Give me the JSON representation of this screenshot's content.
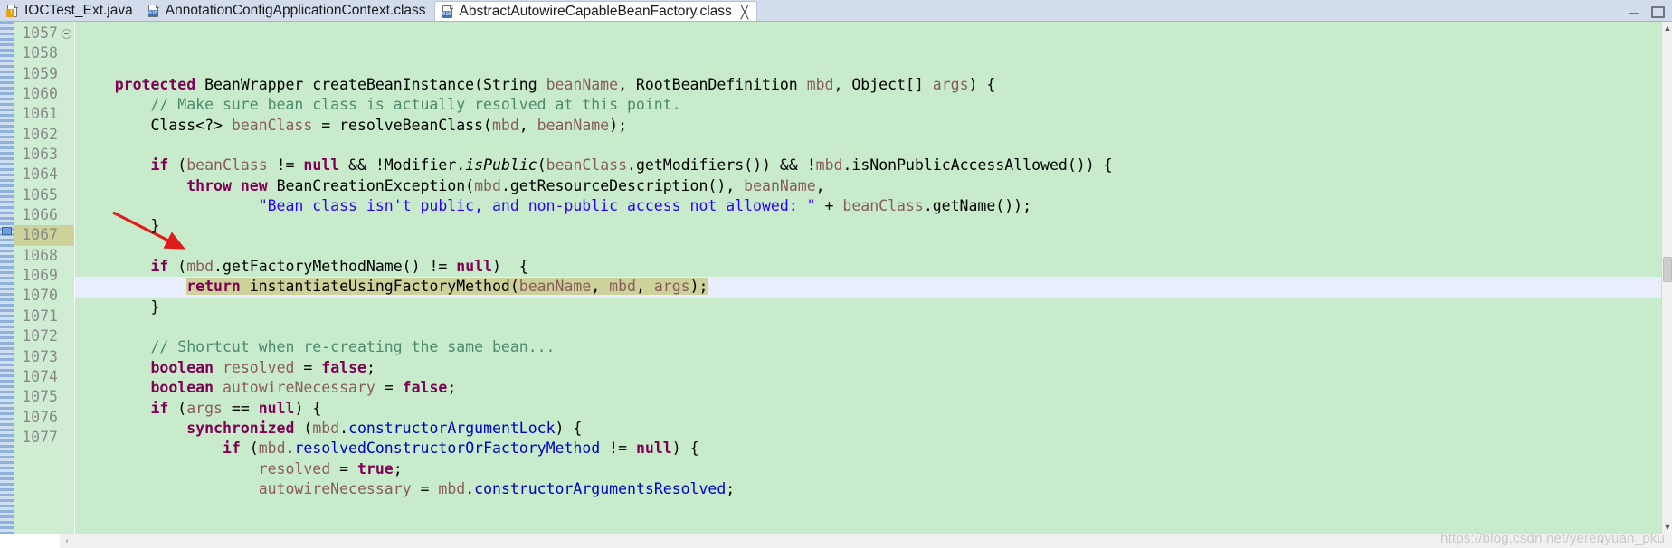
{
  "window": {
    "minimize_label": "Minimize",
    "maximize_label": "Maximize"
  },
  "tabs": [
    {
      "label": "IOCTest_Ext.java",
      "icon": "java-file-icon",
      "active": false,
      "closable": false
    },
    {
      "label": "AnnotationConfigApplicationContext.class",
      "icon": "class-file-icon",
      "active": false,
      "closable": false
    },
    {
      "label": "AbstractAutowireCapableBeanFactory.class",
      "icon": "class-file-icon",
      "active": true,
      "closable": true,
      "close_glyph": "╳"
    }
  ],
  "editor": {
    "first_line": 1057,
    "current_line": 1067,
    "fold_line": 1057,
    "colors": {
      "background": "#c8ebcc",
      "gutter_background": "#cfedd2",
      "current_line_background": "#e8eefb",
      "selection_background": "#cdd29a",
      "keyword": "#7f0055",
      "comment": "#4c8a6e",
      "parameter": "#8a5c5c",
      "field": "#0000c0",
      "string": "#2a00ff",
      "arrow": "#e01b1b"
    },
    "lines": [
      {
        "num": "1057",
        "text": "    protected BeanWrapper createBeanInstance(String beanName, RootBeanDefinition mbd, Object[] args) {"
      },
      {
        "num": "1058",
        "text": "        // Make sure bean class is actually resolved at this point."
      },
      {
        "num": "1059",
        "text": "        Class<?> beanClass = resolveBeanClass(mbd, beanName);"
      },
      {
        "num": "1060",
        "text": ""
      },
      {
        "num": "1061",
        "text": "        if (beanClass != null && !Modifier.isPublic(beanClass.getModifiers()) && !mbd.isNonPublicAccessAllowed()) {"
      },
      {
        "num": "1062",
        "text": "            throw new BeanCreationException(mbd.getResourceDescription(), beanName,"
      },
      {
        "num": "1063",
        "text": "                    \"Bean class isn't public, and non-public access not allowed: \" + beanClass.getName());"
      },
      {
        "num": "1064",
        "text": "        }"
      },
      {
        "num": "1065",
        "text": ""
      },
      {
        "num": "1066",
        "text": "        if (mbd.getFactoryMethodName() != null)  {"
      },
      {
        "num": "1067",
        "text": "            return instantiateUsingFactoryMethod(beanName, mbd, args);"
      },
      {
        "num": "1068",
        "text": "        }"
      },
      {
        "num": "1069",
        "text": ""
      },
      {
        "num": "1070",
        "text": "        // Shortcut when re-creating the same bean..."
      },
      {
        "num": "1071",
        "text": "        boolean resolved = false;"
      },
      {
        "num": "1072",
        "text": "        boolean autowireNecessary = false;"
      },
      {
        "num": "1073",
        "text": "        if (args == null) {"
      },
      {
        "num": "1074",
        "text": "            synchronized (mbd.constructorArgumentLock) {"
      },
      {
        "num": "1075",
        "text": "                if (mbd.resolvedConstructorOrFactoryMethod != null) {"
      },
      {
        "num": "1076",
        "text": "                    resolved = true;"
      },
      {
        "num": "1077",
        "text": "                    autowireNecessary = mbd.constructorArgumentsResolved;"
      }
    ]
  },
  "scrollbars": {
    "vertical_up_glyph": "▲",
    "vertical_down_glyph": "▼",
    "horizontal_left_glyph": "‹",
    "horizontal_right_glyph": "›"
  },
  "watermark": "https://blog.csdn.net/yerenyuan_pku"
}
